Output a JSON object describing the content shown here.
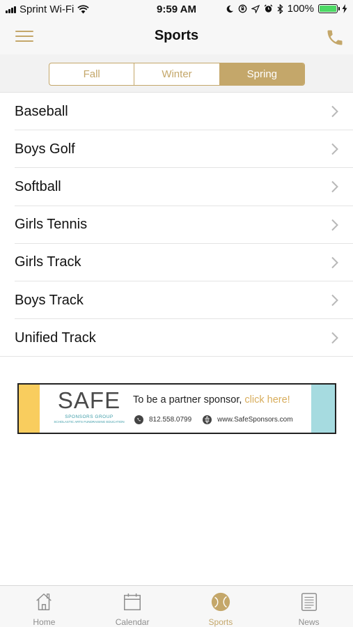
{
  "status_bar": {
    "carrier": "Sprint Wi-Fi",
    "time": "9:59 AM",
    "battery": "100%",
    "battery_level": 1.0
  },
  "nav": {
    "title": "Sports",
    "menu_icon": "hamburger-menu-icon",
    "phone_icon": "phone-icon"
  },
  "seasons": {
    "items": [
      "Fall",
      "Winter",
      "Spring"
    ],
    "selected": "Spring"
  },
  "sports": [
    "Baseball",
    "Boys Golf",
    "Softball",
    "Girls Tennis",
    "Girls Track",
    "Boys Track",
    "Unified Track"
  ],
  "banner": {
    "brand": "SAFE",
    "brand_sub": "SPONSORS GROUP",
    "brand_tagline": "SCHOLASTIC ARTS FUNDRAISING EDUCATION",
    "cta_text": "To be a partner sponsor,",
    "cta_link": "click here!",
    "phone": "812.558.0799",
    "website": "www.SafeSponsors.com"
  },
  "tabs": [
    {
      "label": "Home",
      "icon": "home-icon"
    },
    {
      "label": "Calendar",
      "icon": "calendar-icon"
    },
    {
      "label": "Sports",
      "icon": "sports-ball-icon"
    },
    {
      "label": "News",
      "icon": "news-icon"
    }
  ],
  "active_tab": "Sports",
  "colors": {
    "accent": "#c4a76a",
    "banner_yellow": "#f9cd5e",
    "banner_teal": "#a6dbe0",
    "battery_green": "#4cd964"
  }
}
